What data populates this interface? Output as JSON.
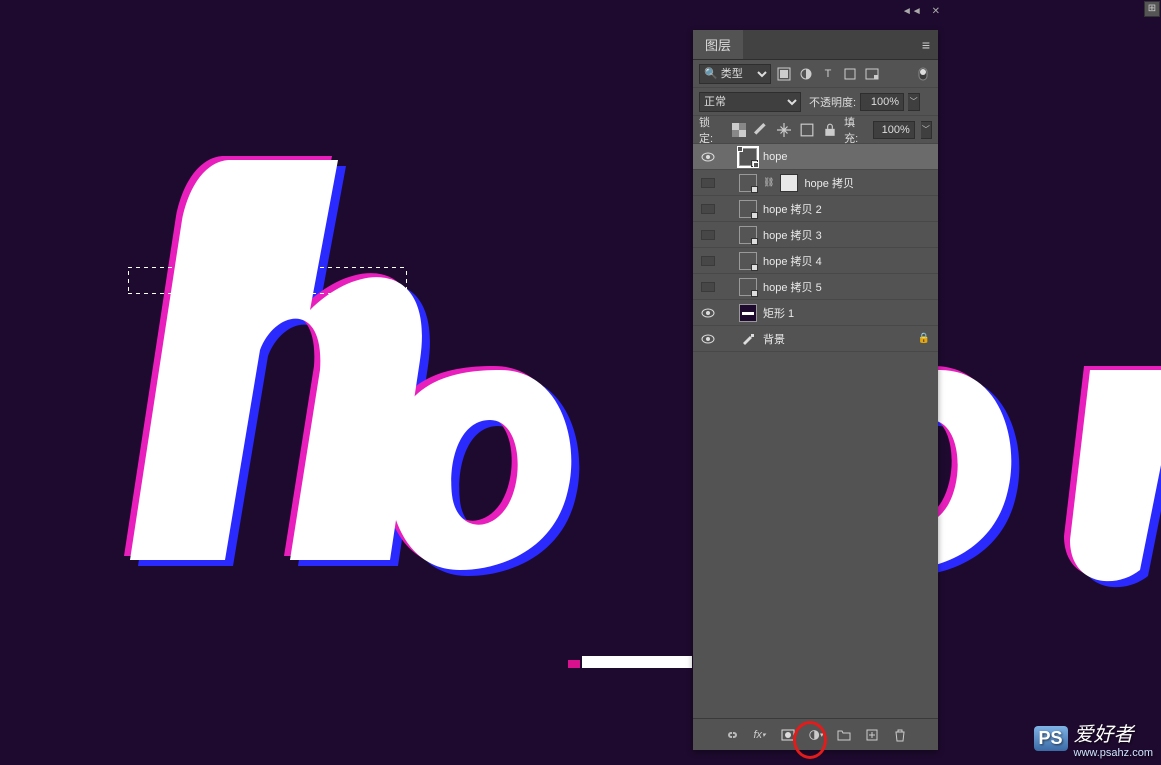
{
  "panel": {
    "tab_label": "图层",
    "filter": {
      "search_prefix": "🔍",
      "type_label": "类型"
    },
    "blend": {
      "mode": "正常",
      "opacity_label": "不透明度:",
      "opacity_value": "100%"
    },
    "lock": {
      "label": "锁定:",
      "fill_label": "填充:",
      "fill_value": "100%"
    },
    "layers": [
      {
        "visible": true,
        "selected": true,
        "kind": "smart-selected",
        "name": "hope"
      },
      {
        "visible": false,
        "selected": false,
        "kind": "smart-mask",
        "name": "hope 拷贝"
      },
      {
        "visible": false,
        "selected": false,
        "kind": "smart",
        "name": "hope 拷贝 2"
      },
      {
        "visible": false,
        "selected": false,
        "kind": "smart",
        "name": "hope 拷贝 3"
      },
      {
        "visible": false,
        "selected": false,
        "kind": "smart",
        "name": "hope 拷贝 4"
      },
      {
        "visible": false,
        "selected": false,
        "kind": "smart",
        "name": "hope 拷贝 5"
      },
      {
        "visible": true,
        "selected": false,
        "kind": "shape",
        "name": "矩形 1"
      },
      {
        "visible": true,
        "selected": false,
        "kind": "brush",
        "name": "背景",
        "locked": true
      }
    ]
  },
  "watermark": {
    "badge": "PS",
    "title": "爱好者",
    "url": "www.psahz.com"
  },
  "props_icon": "⊞"
}
